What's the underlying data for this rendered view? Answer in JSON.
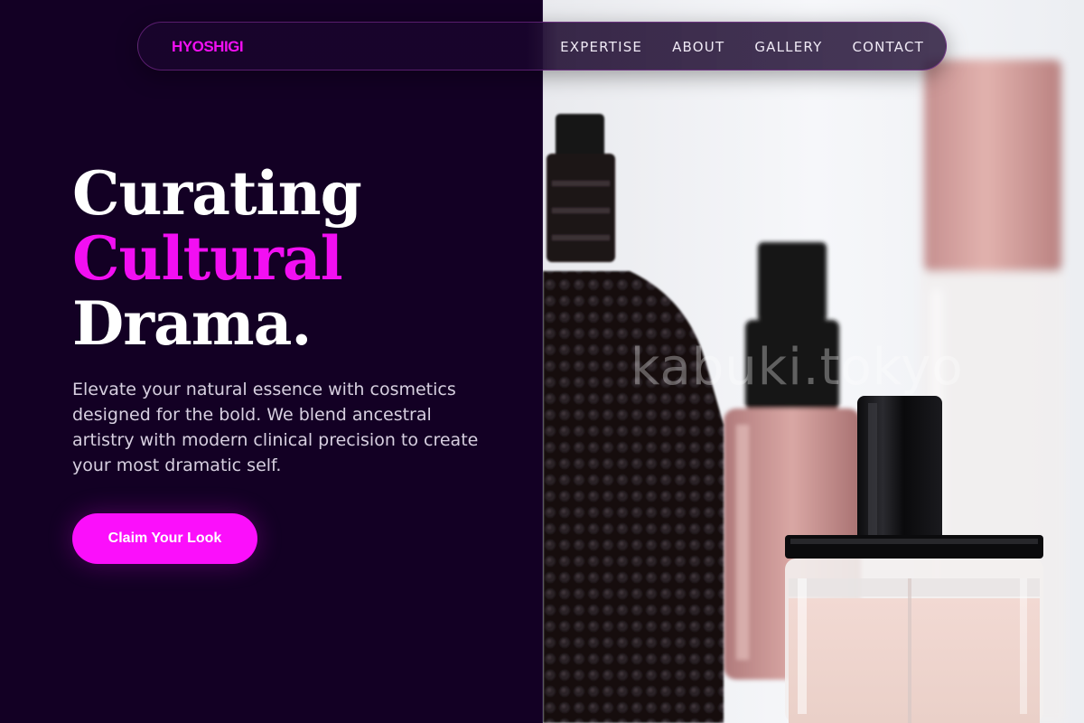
{
  "nav": {
    "brand": "HYOSHIGI",
    "links": [
      "EXPERTISE",
      "ABOUT",
      "GALLERY",
      "CONTACT"
    ]
  },
  "hero": {
    "headline_line1": "Curating",
    "headline_line2": "Cultural",
    "headline_line3": "Drama.",
    "description": "Elevate your natural essence with cosmetics designed for the bold. We blend ancestral artistry with modern clinical precision to create your most dramatic self.",
    "cta_label": "Claim Your Look"
  },
  "image": {
    "watermark": "kabuki.tokyo"
  },
  "colors": {
    "background": "#130024",
    "accent": "#f20ff2",
    "button": "#fb0ffb",
    "text_light": "#ffffff",
    "text_muted": "#d7cfe0"
  }
}
